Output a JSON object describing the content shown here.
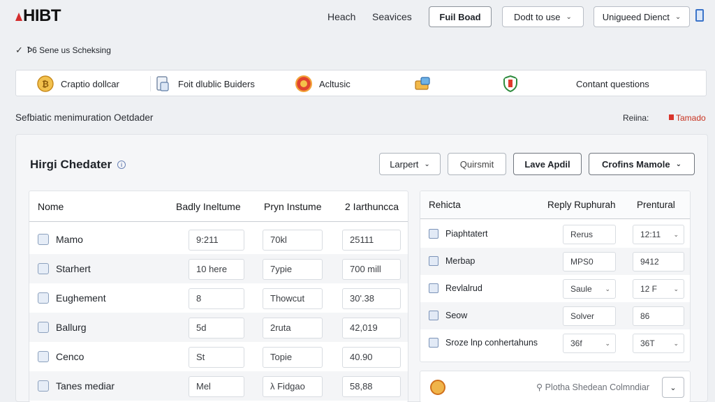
{
  "header": {
    "logo_text": "HIBT",
    "nav": [
      "Heach",
      "Seavices"
    ],
    "btn_full": "Fuil Boad",
    "dropdown1": "Dodt to use",
    "dropdown2": "Unigueed Dienct"
  },
  "subhead": {
    "icon": "check-icon",
    "text": "Ꝥ6 Sene us Scheksing"
  },
  "categories": [
    {
      "label": "Craptio dollcar",
      "icon": "bitcoin-icon"
    },
    {
      "label": "Foit dlublic Buiders",
      "icon": "document-icon"
    },
    {
      "label": "Acltusic",
      "icon": "coin-icon"
    },
    {
      "label": "",
      "icon": "wallet-icon"
    },
    {
      "label": "Contant questions",
      "icon": "shield-icon"
    }
  ],
  "section": {
    "left": "Sefbiatic menimuration Oetdader",
    "right_a": "Reiina:",
    "right_b": "Tamado"
  },
  "card": {
    "title": "Hirgi Chedater",
    "btn_larpert": "Larpert",
    "btn_quirsmit": "Quirsmit",
    "btn_lave": "Lave Apdil",
    "btn_crofin": "Crofins Mamole"
  },
  "left_table": {
    "headers": [
      "Nome",
      "Badly Ineltume",
      "Pryn Instume",
      "2 Iarthuncca"
    ],
    "rows": [
      {
        "name": "Mamo",
        "a": "9:211",
        "b": "70kl",
        "c": "25111"
      },
      {
        "name": "Starhert",
        "a": "10 here",
        "b": "7ypie",
        "c": "700 mill"
      },
      {
        "name": "Eughement",
        "a": "8",
        "b": "Thowcut",
        "c": "30'.38"
      },
      {
        "name": "Ballurg",
        "a": "5d",
        "b": "2ruta",
        "c": "42,019"
      },
      {
        "name": "Cenco",
        "a": "St",
        "b": "Topie",
        "c": "40.90"
      },
      {
        "name": "Tanes mediar",
        "a": "Mel",
        "b": "λ Fidgao",
        "c": "58,88"
      }
    ]
  },
  "right_table": {
    "headers": [
      "Rehicta",
      "Reply Ruphurah",
      "Prentural"
    ],
    "rows": [
      {
        "name": "Piaphtatert",
        "a": "Rerus",
        "b": "12:11",
        "b_chev": true
      },
      {
        "name": "Merbap",
        "a": "MPS0",
        "b": "9412",
        "b_chev": false
      },
      {
        "name": "Revlalrud",
        "a": "Saule",
        "a_chev": true,
        "b": "12 F",
        "b_chev": true
      },
      {
        "name": "Seow",
        "a": "Solver",
        "b": "86",
        "b_chev": false
      },
      {
        "name": "Sroze lnp conhertahuns",
        "a": "36f",
        "a_chev": true,
        "b": "36T",
        "b_chev": true
      }
    ]
  },
  "bottom_panel": {
    "text": "⚲ Plotha Shedean Colmndiar"
  }
}
